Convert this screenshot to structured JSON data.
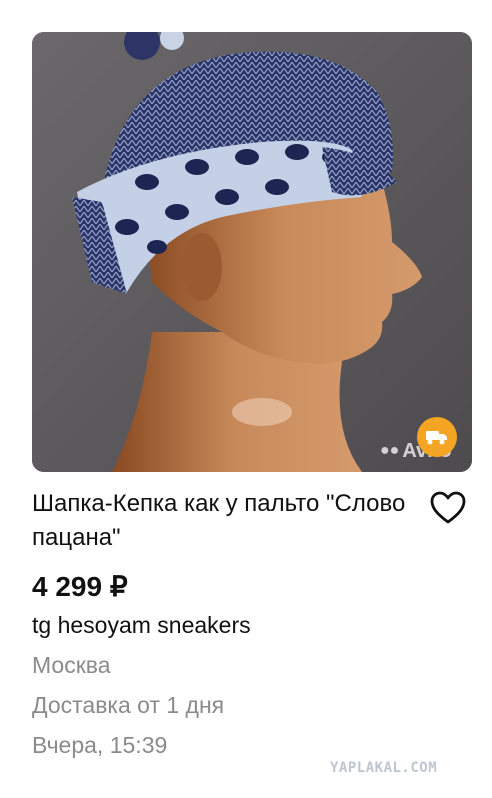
{
  "listing": {
    "title": "Шапка-Кепка как у пальто \"Слово пацана\"",
    "price": "4 299 ₽",
    "seller": "tg hesoyam sneakers",
    "city": "Москва",
    "delivery": "Доставка от 1 дня",
    "date": "Вчера, 15:39"
  },
  "photo": {
    "watermark": "Avito",
    "badge_icon": "truck-icon",
    "badge_color": "#f5a524"
  },
  "favorite": {
    "icon": "heart-outline-icon"
  },
  "footer": {
    "watermark": "YAPLAKAL.COM"
  },
  "colors": {
    "text": "#111111",
    "muted": "#8b8b8b",
    "photo_bg": "#5f5c5f"
  }
}
